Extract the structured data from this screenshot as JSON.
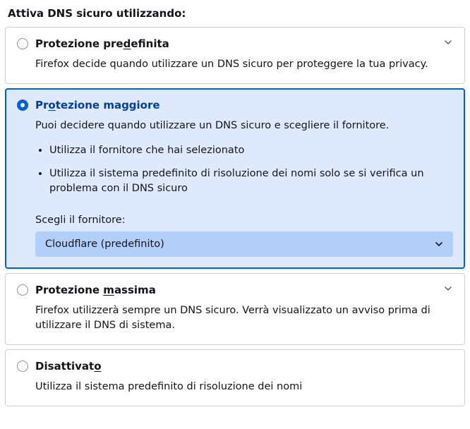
{
  "heading": "Attiva DNS sicuro utilizzando:",
  "options": {
    "default": {
      "title_pre": "Protezione pre",
      "title_ul": "d",
      "title_post": "efinita",
      "desc": "Firefox decide quando utilizzare un DNS sicuro per proteggere la tua privacy."
    },
    "increased": {
      "title_pre": "Pr",
      "title_ul": "o",
      "title_post": "tezione maggiore",
      "desc": "Puoi decidere quando utilizzare un DNS sicuro e scegliere il fornitore.",
      "bullet1": "Utilizza il fornitore che hai selezionato",
      "bullet2": "Utilizza il sistema predefinito di risoluzione dei nomi solo se si verifica un problema con il DNS sicuro",
      "provider_label": "Scegli il fornitore:",
      "provider_value": "Cloudflare (predefinito)"
    },
    "max": {
      "title_pre": "Protezione ",
      "title_ul": "m",
      "title_post": "assima",
      "desc": "Firefox utilizzerà sempre un DNS sicuro. Verrà visualizzato un avviso prima di utilizzare il DNS di sistema."
    },
    "off": {
      "title_pre": "Disattivat",
      "title_ul": "o",
      "title_post": "",
      "desc": "Utilizza il sistema predefinito di risoluzione dei nomi"
    }
  }
}
